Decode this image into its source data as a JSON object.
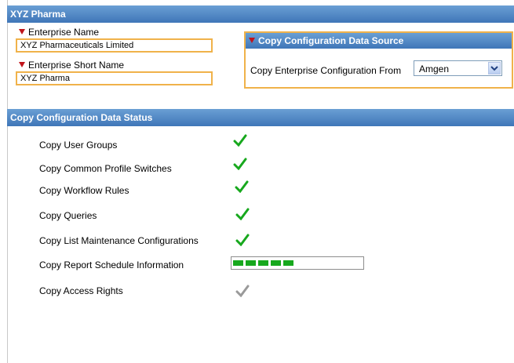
{
  "header": {
    "title": "XYZ Pharma"
  },
  "enterprise": {
    "name_label": "Enterprise Name",
    "name_value": "XYZ Pharmaceuticals Limited",
    "short_name_label": "Enterprise Short Name",
    "short_name_value": "XYZ Pharma"
  },
  "copy_source": {
    "title": "Copy Configuration Data Source",
    "from_label": "Copy Enterprise Configuration From",
    "selected": "Amgen"
  },
  "status": {
    "title": "Copy Configuration Data Status",
    "items": [
      {
        "label": "Copy User Groups",
        "state": "done"
      },
      {
        "label": "Copy Common Profile Switches",
        "state": "done"
      },
      {
        "label": "Copy Workflow Rules",
        "state": "done"
      },
      {
        "label": "Copy Queries",
        "state": "done"
      },
      {
        "label": "Copy List Maintenance Configurations",
        "state": "done"
      },
      {
        "label": "Copy Report Schedule Information",
        "state": "in-progress",
        "progress_segments": 5
      },
      {
        "label": "Copy Access Rights",
        "state": "pending"
      }
    ]
  },
  "colors": {
    "header_blue": "#3f76b8",
    "required_flag": "#c0141b",
    "input_border": "#f0b24a",
    "check_done": "#17a81d",
    "check_pending": "#9a9a9a",
    "progress_fill": "#17a81d"
  },
  "icons": {
    "required": "required-flag-icon",
    "done": "checkmark-icon",
    "pending": "checkmark-pending-icon",
    "dropdown": "chevron-down-icon"
  }
}
